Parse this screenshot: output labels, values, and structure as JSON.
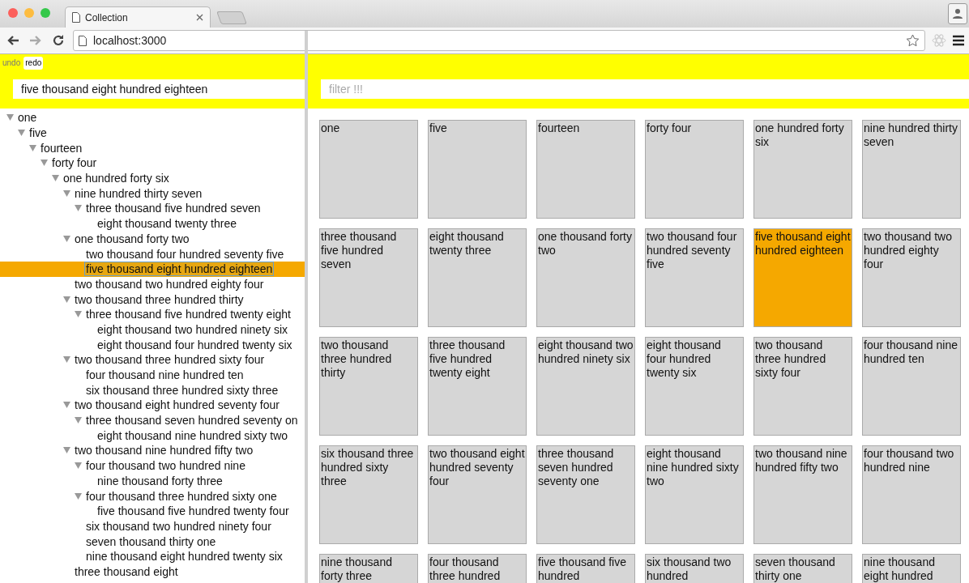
{
  "browser": {
    "tab_title": "Collection",
    "url": "localhost:3000"
  },
  "history": [
    {
      "label": "undo",
      "disabled": true
    },
    {
      "label": "redo",
      "disabled": false
    }
  ],
  "search": {
    "value": "five thousand eight hundred eighteen"
  },
  "filter": {
    "placeholder": "filter !!!"
  },
  "tree": [
    {
      "label": "one",
      "expanded": true,
      "selected": false,
      "children": [
        {
          "label": "five",
          "expanded": true,
          "selected": false,
          "children": [
            {
              "label": "fourteen",
              "expanded": true,
              "selected": false,
              "children": [
                {
                  "label": "forty four",
                  "expanded": true,
                  "selected": false,
                  "children": [
                    {
                      "label": "one hundred forty six",
                      "expanded": true,
                      "selected": false,
                      "children": [
                        {
                          "label": "nine hundred thirty seven",
                          "expanded": true,
                          "selected": false,
                          "children": [
                            {
                              "label": "three thousand five hundred seven",
                              "expanded": true,
                              "selected": false,
                              "children": [
                                {
                                  "label": "eight thousand twenty three",
                                  "selected": false
                                }
                              ]
                            }
                          ]
                        },
                        {
                          "label": "one thousand forty two",
                          "expanded": true,
                          "selected": false,
                          "children": [
                            {
                              "label": "two thousand four hundred seventy five",
                              "selected": false
                            },
                            {
                              "label": "five thousand eight hundred eighteen",
                              "selected": true
                            }
                          ]
                        },
                        {
                          "label": "two thousand two hundred eighty four",
                          "selected": false
                        },
                        {
                          "label": "two thousand three hundred thirty",
                          "expanded": true,
                          "selected": false,
                          "children": [
                            {
                              "label": "three thousand five hundred twenty eight",
                              "expanded": true,
                              "selected": false,
                              "children": [
                                {
                                  "label": "eight thousand two hundred ninety six",
                                  "selected": false
                                },
                                {
                                  "label": "eight thousand four hundred twenty six",
                                  "selected": false
                                }
                              ]
                            }
                          ]
                        },
                        {
                          "label": "two thousand three hundred sixty four",
                          "expanded": true,
                          "selected": false,
                          "children": [
                            {
                              "label": "four thousand nine hundred ten",
                              "selected": false
                            },
                            {
                              "label": "six thousand three hundred sixty three",
                              "selected": false
                            }
                          ]
                        },
                        {
                          "label": "two thousand eight hundred seventy four",
                          "expanded": true,
                          "selected": false,
                          "children": [
                            {
                              "label": "three thousand seven hundred seventy on",
                              "expanded": true,
                              "selected": false,
                              "children": [
                                {
                                  "label": "eight thousand nine hundred sixty two",
                                  "selected": false
                                }
                              ]
                            }
                          ]
                        },
                        {
                          "label": "two thousand nine hundred fifty two",
                          "expanded": true,
                          "selected": false,
                          "children": [
                            {
                              "label": "four thousand two hundred nine",
                              "expanded": true,
                              "selected": false,
                              "children": [
                                {
                                  "label": "nine thousand forty three",
                                  "selected": false
                                }
                              ]
                            },
                            {
                              "label": "four thousand three hundred sixty one",
                              "expanded": true,
                              "selected": false,
                              "children": [
                                {
                                  "label": "five thousand five hundred twenty four",
                                  "selected": false
                                }
                              ]
                            },
                            {
                              "label": "six thousand two hundred ninety four",
                              "selected": false
                            },
                            {
                              "label": "seven thousand thirty one",
                              "selected": false
                            },
                            {
                              "label": "nine thousand eight hundred twenty six",
                              "selected": false
                            }
                          ]
                        },
                        {
                          "label": "three thousand eight",
                          "selected": false
                        }
                      ]
                    }
                  ]
                }
              ]
            }
          ]
        }
      ]
    }
  ],
  "cards": [
    {
      "label": "one",
      "selected": false
    },
    {
      "label": "five",
      "selected": false
    },
    {
      "label": "fourteen",
      "selected": false
    },
    {
      "label": "forty four",
      "selected": false
    },
    {
      "label": "one hundred forty six",
      "selected": false
    },
    {
      "label": "nine hundred thirty seven",
      "selected": false
    },
    {
      "label": "three thousand five hundred seven",
      "selected": false
    },
    {
      "label": "eight thousand twenty three",
      "selected": false
    },
    {
      "label": "one thousand forty two",
      "selected": false
    },
    {
      "label": "two thousand four hundred seventy five",
      "selected": false
    },
    {
      "label": "five thousand eight hundred eighteen",
      "selected": true
    },
    {
      "label": "two thousand two hundred eighty four",
      "selected": false
    },
    {
      "label": "two thousand three hundred thirty",
      "selected": false
    },
    {
      "label": "three thousand five hundred twenty eight",
      "selected": false
    },
    {
      "label": "eight thousand two hundred ninety six",
      "selected": false
    },
    {
      "label": "eight thousand four hundred twenty six",
      "selected": false
    },
    {
      "label": "two thousand three hundred sixty four",
      "selected": false
    },
    {
      "label": "four thousand nine hundred ten",
      "selected": false
    },
    {
      "label": "six thousand three hundred sixty three",
      "selected": false
    },
    {
      "label": "two thousand eight hundred seventy four",
      "selected": false
    },
    {
      "label": "three thousand seven hundred seventy one",
      "selected": false
    },
    {
      "label": "eight thousand nine hundred sixty two",
      "selected": false
    },
    {
      "label": "two thousand nine hundred fifty two",
      "selected": false
    },
    {
      "label": "four thousand two hundred nine",
      "selected": false
    },
    {
      "label": "nine thousand forty three",
      "selected": false
    },
    {
      "label": "four thousand three hundred",
      "selected": false
    },
    {
      "label": "five thousand five hundred",
      "selected": false
    },
    {
      "label": "six thousand two hundred",
      "selected": false
    },
    {
      "label": "seven thousand thirty one",
      "selected": false
    },
    {
      "label": "nine thousand eight hundred",
      "selected": false
    }
  ]
}
